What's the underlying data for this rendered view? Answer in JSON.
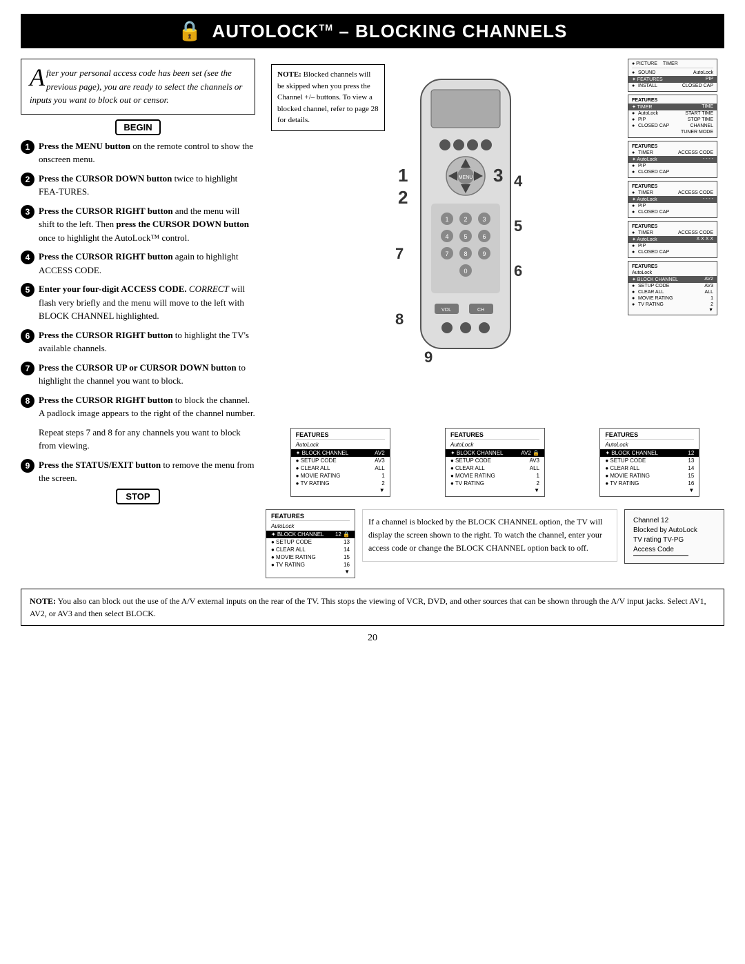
{
  "header": {
    "title": "AutoLock",
    "tm": "TM",
    "dash": "–",
    "subtitle": "Blocking Channels"
  },
  "intro": {
    "drop_cap": "A",
    "text": "fter your personal access code has been set (see the previous page), you are ready to select the channels or inputs you want to block out or censor."
  },
  "begin_label": "BEGIN",
  "stop_label": "STOP",
  "steps": [
    {
      "num": "1",
      "html": "Press the <b>MENU button</b> on the remote control to show the onscreen menu."
    },
    {
      "num": "2",
      "html": "Press the <b>CURSOR DOWN button</b> twice to highlight FEA-TURES."
    },
    {
      "num": "3",
      "html": "Press the <b>CURSOR RIGHT button</b> and the menu will shift to the left. Then <b>press the CURSOR DOWN button</b> once to highlight the AutoLock™ control."
    },
    {
      "num": "4",
      "html": "Press the <b>CURSOR RIGHT button</b> again to highlight ACCESS CODE."
    },
    {
      "num": "5",
      "html": "<b>Enter your four-digit ACCESS CODE.</b> <i>CORRECT</i> will flash very briefly and the menu will move to the left with BLOCK CHANNEL highlighted."
    },
    {
      "num": "6",
      "html": "Press the <b>CURSOR RIGHT button</b> to highlight the TV's available channels."
    },
    {
      "num": "7",
      "html": "Press the <b>CURSOR UP or CURSOR DOWN button</b> to highlight the channel you want to block."
    },
    {
      "num": "8",
      "html": "Press the <b>CURSOR RIGHT button</b> to block the channel. A padlock image appears to the right of the channel number."
    },
    {
      "num": "repeat",
      "html": "Repeat steps 7 and 8 for any channels you want to block from viewing."
    },
    {
      "num": "9",
      "html": "Press the <b>STATUS/EXIT button</b> to remove the menu from the screen."
    }
  ],
  "note": {
    "label": "NOTE:",
    "text": "Blocked channels will be skipped when you press the Channel +/– buttons. To view a blocked channel, refer to page 28 for details."
  },
  "screens": {
    "screen1": {
      "title": "FEATURES",
      "menu_items": [
        "PICTURE",
        "SOUND",
        "FEATURES",
        "INSTALL"
      ],
      "menu_right": [
        "TIMER",
        "AutoLock",
        "PIP",
        "CLOSED CAP"
      ],
      "selected": "FEATURES"
    },
    "screen2": {
      "title": "FEATURES",
      "subtitle": "TIMER",
      "items": [
        "AutoLock",
        "PIP",
        "CLOSED CAP"
      ],
      "right_items": [
        "TIME",
        "START TIME",
        "STOP TIME",
        "CHANNEL",
        "TUNER MODE"
      ],
      "selected": "TIMER"
    },
    "screen3": {
      "title": "FEATURES",
      "subtitle": "TIMER",
      "items": [
        "AutoLock",
        "PIP",
        "CLOSED CAP"
      ],
      "right_label": "ACCESS CODE",
      "access_code": "- - - -",
      "selected": "AutoLock"
    },
    "screen4": {
      "title": "FEATURES",
      "items": [
        "TIMER",
        "AutoLock",
        "PIP",
        "CLOSED CAP"
      ],
      "right_label": "ACCESS CODE",
      "access_code": "- - - -",
      "selected": "AutoLock"
    },
    "screen5": {
      "title": "FEATURES",
      "items": [
        "TIMER",
        "AutoLock",
        "PIP",
        "CLOSED CAP"
      ],
      "right_label": "ACCESS CODE",
      "access_code": "X X X X",
      "selected": "AutoLock"
    },
    "screen6": {
      "title": "FEATURES",
      "subtitle": "AutoLock",
      "items": [
        "BLOCK CHANNEL",
        "SETUP CODE",
        "CLEAR ALL",
        "MOVIE RATING",
        "TV RATING"
      ],
      "values": [
        "AV2",
        "AV3",
        "ALL",
        "1",
        "2"
      ],
      "selected": "BLOCK CHANNEL"
    }
  },
  "bottom_screens": {
    "screen_a": {
      "title": "FEATURES",
      "subtitle": "AutoLock",
      "items": [
        "BLOCK CHANNEL",
        "SETUP CODE",
        "CLEAR ALL",
        "MOVIE RATING",
        "TV RATING"
      ],
      "values": [
        "AV2",
        "AV3",
        "ALL",
        "1",
        "2"
      ],
      "channel_icon": true,
      "selected": "BLOCK CHANNEL"
    },
    "screen_b": {
      "title": "FEATURES",
      "subtitle": "AutoLock",
      "items": [
        "BLOCK CHANNEL",
        "SETUP CODE",
        "CLEAR ALL",
        "MOVIE RATING",
        "TV RATING"
      ],
      "values": [
        "AV2 🔒",
        "AV3",
        "ALL",
        "1",
        "2"
      ],
      "selected": "BLOCK CHANNEL"
    },
    "screen_c": {
      "title": "FEATURES",
      "subtitle": "AutoLock",
      "items": [
        "BLOCK CHANNEL",
        "SETUP CODE",
        "CLEAR ALL",
        "MOVIE RATING",
        "TV RATING"
      ],
      "values": [
        "12",
        "13",
        "14",
        "15",
        "16"
      ],
      "selected": "BLOCK CHANNEL"
    }
  },
  "final_screens": {
    "small_screen": {
      "title": "FEATURES",
      "subtitle": "AutoLock",
      "items": [
        "BLOCK CHANNEL",
        "SETUP CODE",
        "CLEAR ALL",
        "MOVIE RATING",
        "TV RATING"
      ],
      "values": [
        "12 🔒",
        "13",
        "14",
        "15",
        "16"
      ]
    },
    "blocked_message": {
      "title": "If a channel is blocked by the BLOCK CHANNEL option, the TV will display the screen shown to the right. To watch the channel, enter your access code or change the BLOCK CHANNEL option back to off."
    },
    "channel_screen": {
      "line1": "Channel 12",
      "line2": "Blocked by AutoLock",
      "line3": "TV rating TV-PG",
      "line4": "Access Code",
      "line5": "_____"
    }
  },
  "bottom_note": {
    "text": "NOTE:  You also can block out the use of the A/V external inputs on the rear of the TV. This stops the viewing of VCR, DVD, and other sources that can be shown through the A/V input jacks. Select AV1, AV2, or AV3 and then select BLOCK."
  },
  "page_number": "20"
}
